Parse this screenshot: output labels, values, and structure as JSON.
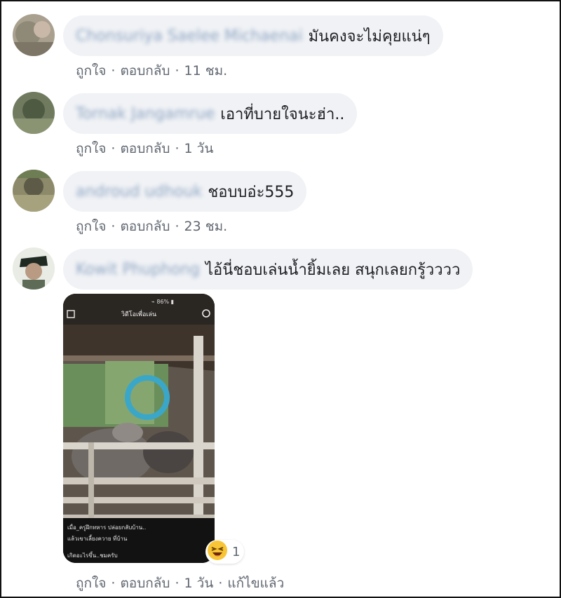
{
  "comments": [
    {
      "author": "Chonsuriya Saelee Michaenai",
      "text": "มันคงจะไม่คุยแน่ๆ",
      "like": "ถูกใจ",
      "reply": "ตอบกลับ",
      "time": "11 ชม."
    },
    {
      "author": "Tornak Jangamrue",
      "text": "เอาที่บายใจนะฮ่า..",
      "like": "ถูกใจ",
      "reply": "ตอบกลับ",
      "time": "1 วัน"
    },
    {
      "author": "androud udhouk",
      "text": "ชอบบอ่ะ555",
      "like": "ถูกใจ",
      "reply": "ตอบกลับ",
      "time": "23 ชม."
    },
    {
      "author": "Kowit Phuphong",
      "text": "ไอ้นี่ชอบเล่นน้ำยิ้มเลย สนุกเลยกรู้วววว",
      "like": "ถูกใจ",
      "reply": "ตอบกลับ",
      "time": "1 วัน",
      "edited": "แก้ไขแล้ว",
      "reaction_count": "1",
      "media_caption_lines": [
        "เมื่อ_ครูฝึกทหาร ปล่อยกลับบ้าน..",
        "แล้วเขาเลี้ยงควาย ที่บ้าน",
        "เกิดอะไรขึ้น..ชมครับ"
      ],
      "media_header": "วิดีโอเพื่อเล่น"
    }
  ]
}
